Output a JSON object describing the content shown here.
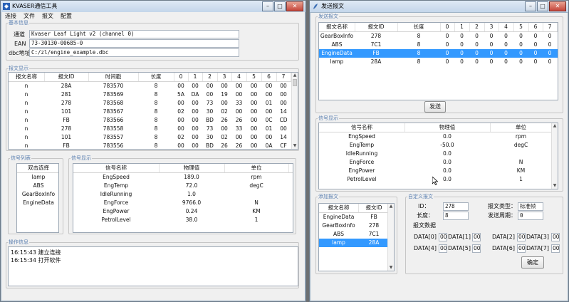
{
  "left_window": {
    "title": "KVASER通信工具",
    "menu": [
      "连接",
      "文件",
      "报文",
      "配置"
    ],
    "device_group": {
      "legend": "基本信息",
      "channel_label": "通道",
      "channel_value": "Kvaser Leaf Light v2 (channel 0)",
      "ean_label": "EAN",
      "ean_value": "73-30130-00685-0",
      "dbc_label": "dbc地址",
      "dbc_value": "C:/zl/engine_example.dbc"
    },
    "msg_display": {
      "legend": "报文显示",
      "headers": [
        "报文名称",
        "报文ID",
        "时间戳",
        "长度",
        "0",
        "1",
        "2",
        "3",
        "4",
        "5",
        "6",
        "7"
      ],
      "rows": [
        [
          "n",
          "28A",
          "783570",
          "8",
          "00",
          "00",
          "00",
          "00",
          "00",
          "00",
          "00",
          "00"
        ],
        [
          "n",
          "281",
          "783569",
          "8",
          "5A",
          "DA",
          "00",
          "19",
          "00",
          "00",
          "00",
          "00"
        ],
        [
          "n",
          "278",
          "783568",
          "8",
          "00",
          "00",
          "73",
          "00",
          "33",
          "00",
          "01",
          "00"
        ],
        [
          "n",
          "101",
          "783567",
          "8",
          "02",
          "00",
          "30",
          "02",
          "00",
          "00",
          "00",
          "14"
        ],
        [
          "n",
          "FB",
          "783566",
          "8",
          "00",
          "00",
          "BD",
          "26",
          "26",
          "00",
          "0C",
          "CD"
        ],
        [
          "n",
          "278",
          "783558",
          "8",
          "00",
          "00",
          "73",
          "00",
          "33",
          "00",
          "01",
          "00"
        ],
        [
          "n",
          "101",
          "783557",
          "8",
          "02",
          "00",
          "30",
          "02",
          "00",
          "00",
          "00",
          "14"
        ],
        [
          "n",
          "FB",
          "783556",
          "8",
          "00",
          "00",
          "BD",
          "26",
          "26",
          "00",
          "0A",
          "CF"
        ]
      ]
    },
    "signal_list": {
      "legend": "信号列表",
      "header": "双击选择",
      "items": [
        "lamp",
        "ABS",
        "GearBoxInfo",
        "EngineData"
      ]
    },
    "signal_display": {
      "legend": "信号显示",
      "headers": [
        "信号名称",
        "物理值",
        "单位"
      ],
      "rows": [
        [
          "EngSpeed",
          "189.0",
          "rpm"
        ],
        [
          "EngTemp",
          "72.0",
          "degC"
        ],
        [
          "IdleRunning",
          "1.0",
          ""
        ],
        [
          "EngForce",
          "9766.0",
          "N"
        ],
        [
          "EngPower",
          "0.24",
          "KM"
        ],
        [
          "PetrolLevel",
          "38.0",
          "1"
        ]
      ]
    },
    "op_log": {
      "legend": "操作信息",
      "lines": [
        "16:15:43    建立连接",
        "16:15:34    打开软件"
      ]
    }
  },
  "right_window": {
    "title": "发送报文",
    "send_group": {
      "legend": "发送报文",
      "headers": [
        "报文名称",
        "报文ID",
        "长度",
        "0",
        "1",
        "2",
        "3",
        "4",
        "5",
        "6",
        "7"
      ],
      "rows": [
        [
          "GearBoxInfo",
          "278",
          "8",
          "0",
          "0",
          "0",
          "0",
          "0",
          "0",
          "0",
          "0"
        ],
        [
          "ABS",
          "7C1",
          "8",
          "0",
          "0",
          "0",
          "0",
          "0",
          "0",
          "0",
          "0"
        ],
        [
          "EngineData",
          "FB",
          "8",
          "0",
          "0",
          "0",
          "0",
          "0",
          "0",
          "0",
          "0"
        ],
        [
          "lamp",
          "28A",
          "8",
          "0",
          "0",
          "0",
          "0",
          "0",
          "0",
          "0",
          "0"
        ]
      ],
      "selected_row": 2,
      "send_button": "发送"
    },
    "signal_display": {
      "legend": "信号显示",
      "headers": [
        "信号名称",
        "物理值",
        "单位"
      ],
      "rows": [
        [
          "EngSpeed",
          "0.0",
          "rpm"
        ],
        [
          "EngTemp",
          "-50.0",
          "degC"
        ],
        [
          "IdleRunning",
          "0.0",
          ""
        ],
        [
          "EngForce",
          "0.0",
          "N"
        ],
        [
          "EngPower",
          "0.0",
          "KM"
        ],
        [
          "PetrolLevel",
          "0.0",
          "1"
        ]
      ]
    },
    "add_group": {
      "legend": "添加报文",
      "headers": [
        "报文名称",
        "报文ID"
      ],
      "rows": [
        [
          "EngineData",
          "FB"
        ],
        [
          "GearBoxInfo",
          "278"
        ],
        [
          "ABS",
          "7C1"
        ],
        [
          "lamp",
          "28A"
        ]
      ],
      "selected_row": 3
    },
    "custom_group": {
      "legend": "自定义报文",
      "id_label": "ID：",
      "id_value": "278",
      "type_label": "报文类型：",
      "type_value": "标准帧",
      "len_label": "长度：",
      "len_value": "8",
      "period_label": "发送周期：",
      "period_value": "0",
      "data_label": "报文数据",
      "data": [
        {
          "label": "DATA[0]",
          "value": "00"
        },
        {
          "label": "DATA[1]",
          "value": "00"
        },
        {
          "label": "DATA[2]",
          "value": "00"
        },
        {
          "label": "DATA[3]",
          "value": "00"
        },
        {
          "label": "DATA[4]",
          "value": "00"
        },
        {
          "label": "DATA[5]",
          "value": "00"
        },
        {
          "label": "DATA[6]",
          "value": "00"
        },
        {
          "label": "DATA[7]",
          "value": "00"
        }
      ],
      "ok_button": "确定"
    }
  }
}
